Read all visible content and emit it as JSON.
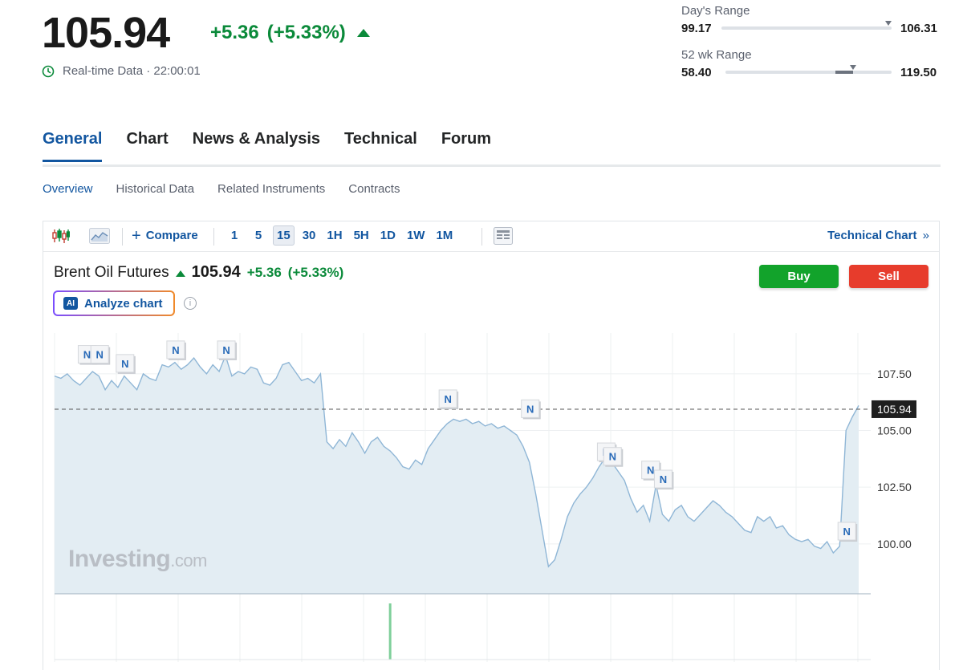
{
  "quote": {
    "price": "105.94",
    "change": "+5.36",
    "change_pct": "(+5.33%)",
    "realtime_label": "Real-time Data · 22:00:01",
    "up_color": "#0b8a3a"
  },
  "days_range": {
    "label": "Day's Range",
    "low": "99.17",
    "high": "106.31",
    "position": 0.98
  },
  "week52_range": {
    "label": "52 wk Range",
    "low": "58.40",
    "high": "119.50",
    "position": 0.77,
    "fill_start": 0.66
  },
  "tabs": [
    {
      "label": "General",
      "active": true
    },
    {
      "label": "Chart",
      "active": false
    },
    {
      "label": "News & Analysis",
      "active": false
    },
    {
      "label": "Technical",
      "active": false
    },
    {
      "label": "Forum",
      "active": false
    }
  ],
  "subtabs": [
    {
      "label": "Overview",
      "active": true
    },
    {
      "label": "Historical Data",
      "active": false
    },
    {
      "label": "Related Instruments",
      "active": false
    },
    {
      "label": "Contracts",
      "active": false
    }
  ],
  "toolbar": {
    "candle_icon": "candlestick-icon",
    "area_icon": "area-chart-icon",
    "compare_label": "Compare",
    "intervals": [
      "1",
      "5",
      "15",
      "30",
      "1H",
      "5H",
      "1D",
      "1W",
      "1M"
    ],
    "active_interval": "15",
    "layout_icon": "layout-icon",
    "technical_chart_label": "Technical Chart",
    "technical_chart_arrow": "»"
  },
  "instrument": {
    "name": "Brent Oil Futures",
    "price": "105.94",
    "change": "+5.36",
    "change_pct": "(+5.33%)"
  },
  "buttons": {
    "buy": "Buy",
    "sell": "Sell",
    "buy_color": "#12a32b",
    "sell_color": "#e73c2c"
  },
  "analyze": {
    "badge": "AI",
    "label": "Analyze chart",
    "info": "i"
  },
  "watermark": {
    "brand": "Investing",
    "suffix": ".com"
  },
  "chart_data": {
    "type": "area",
    "y_ticks": [
      "107.50",
      "105.00",
      "102.50",
      "100.00"
    ],
    "ylim": [
      97.8,
      109.3
    ],
    "last_price_label": "105.94",
    "last_price": 105.94,
    "grid": true,
    "series": [
      {
        "values": [
          107.4,
          107.3,
          107.5,
          107.2,
          107.0,
          107.3,
          107.6,
          107.4,
          106.8,
          107.2,
          106.9,
          107.4,
          107.1,
          106.8,
          107.5,
          107.3,
          107.2,
          107.9,
          107.8,
          108.0,
          107.7,
          107.9,
          108.2,
          107.8,
          107.5,
          107.9,
          107.6,
          108.3,
          107.4,
          107.6,
          107.5,
          107.8,
          107.7,
          107.1,
          107.0,
          107.3,
          107.9,
          108.0,
          107.6,
          107.2,
          107.3,
          107.1,
          107.5,
          104.5,
          104.2,
          104.6,
          104.3,
          104.9,
          104.5,
          104.0,
          104.5,
          104.7,
          104.3,
          104.1,
          103.8,
          103.4,
          103.3,
          103.7,
          103.5,
          104.2,
          104.6,
          105.0,
          105.3,
          105.5,
          105.4,
          105.5,
          105.3,
          105.4,
          105.2,
          105.3,
          105.1,
          105.2,
          105.0,
          104.8,
          104.3,
          103.6,
          102.2,
          100.6,
          99.0,
          99.3,
          100.2,
          101.2,
          101.8,
          102.2,
          102.5,
          102.9,
          103.4,
          103.8,
          103.6,
          103.2,
          102.8,
          102.0,
          101.4,
          101.7,
          101.0,
          102.6,
          101.3,
          101.0,
          101.5,
          101.7,
          101.2,
          101.0,
          101.3,
          101.6,
          101.9,
          101.7,
          101.4,
          101.2,
          100.9,
          100.6,
          100.5,
          101.2,
          101.0,
          101.2,
          100.7,
          100.8,
          100.4,
          100.2,
          100.1,
          100.2,
          99.9,
          99.8,
          100.1,
          99.6,
          99.9,
          105.0,
          105.6,
          106.1
        ]
      }
    ],
    "news_markers": [
      {
        "index": 5,
        "value": 107.9
      },
      {
        "index": 7,
        "value": 107.9
      },
      {
        "index": 11,
        "value": 107.5
      },
      {
        "index": 19,
        "value": 108.1
      },
      {
        "index": 27,
        "value": 108.1
      },
      {
        "index": 62,
        "value": 105.94
      },
      {
        "index": 75,
        "value": 105.5
      },
      {
        "index": 87,
        "value": 103.6
      },
      {
        "index": 88,
        "value": 103.4
      },
      {
        "index": 94,
        "value": 102.8
      },
      {
        "index": 96,
        "value": 102.4
      },
      {
        "index": 125,
        "value": 100.1
      }
    ],
    "news_label": "N",
    "volume": {
      "spike_index": 53,
      "spike_value": 1.0,
      "spike_color": "#7fcf9a"
    }
  }
}
